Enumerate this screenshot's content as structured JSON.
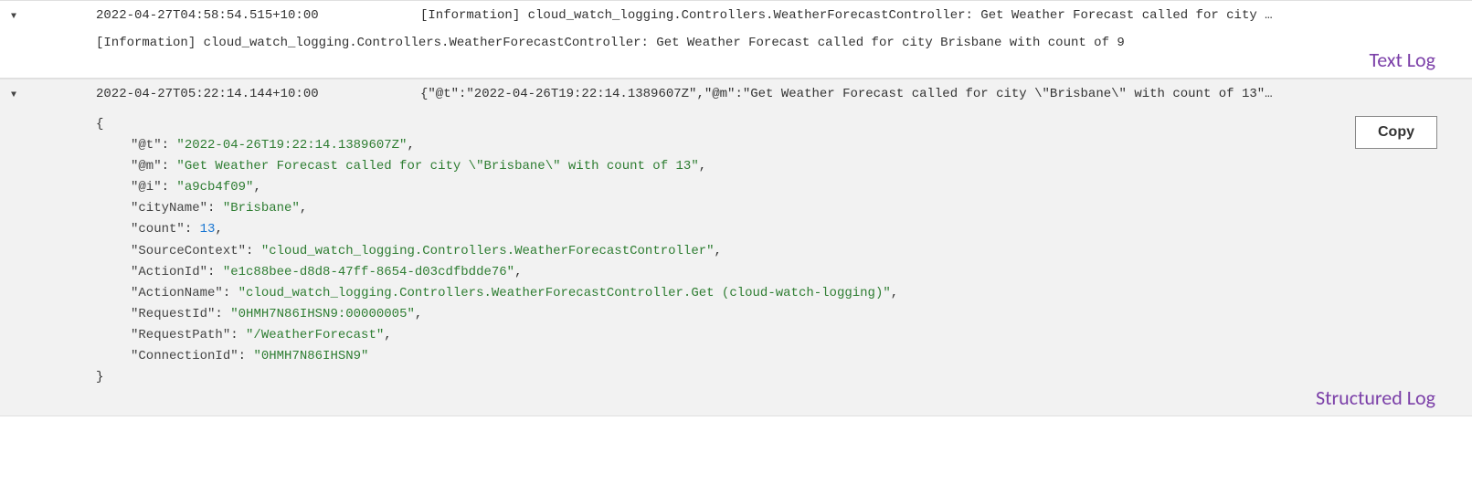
{
  "entries": [
    {
      "timestamp": "2022-04-27T04:58:54.515+10:00",
      "preview": "[Information] cloud_watch_logging.Controllers.WeatherForecastController: Get Weather Forecast called for city …",
      "expanded_text": "[Information] cloud_watch_logging.Controllers.WeatherForecastController: Get Weather Forecast called for city Brisbane with count of 9",
      "annotation": "Text Log"
    },
    {
      "timestamp": "2022-04-27T05:22:14.144+10:00",
      "preview": "{\"@t\":\"2022-04-26T19:22:14.1389607Z\",\"@m\":\"Get Weather Forecast called for city \\\"Brisbane\\\" with count of 13\"…",
      "json_fields": [
        {
          "key": "\"@t\"",
          "value": "\"2022-04-26T19:22:14.1389607Z\"",
          "type": "string"
        },
        {
          "key": "\"@m\"",
          "value": "\"Get Weather Forecast called for city \\\"Brisbane\\\" with count of 13\"",
          "type": "string"
        },
        {
          "key": "\"@i\"",
          "value": "\"a9cb4f09\"",
          "type": "string"
        },
        {
          "key": "\"cityName\"",
          "value": "\"Brisbane\"",
          "type": "string"
        },
        {
          "key": "\"count\"",
          "value": "13",
          "type": "number"
        },
        {
          "key": "\"SourceContext\"",
          "value": "\"cloud_watch_logging.Controllers.WeatherForecastController\"",
          "type": "string"
        },
        {
          "key": "\"ActionId\"",
          "value": "\"e1c88bee-d8d8-47ff-8654-d03cdfbdde76\"",
          "type": "string"
        },
        {
          "key": "\"ActionName\"",
          "value": "\"cloud_watch_logging.Controllers.WeatherForecastController.Get (cloud-watch-logging)\"",
          "type": "string"
        },
        {
          "key": "\"RequestId\"",
          "value": "\"0HMH7N86IHSN9:00000005\"",
          "type": "string"
        },
        {
          "key": "\"RequestPath\"",
          "value": "\"/WeatherForecast\"",
          "type": "string"
        },
        {
          "key": "\"ConnectionId\"",
          "value": "\"0HMH7N86IHSN9\"",
          "type": "string"
        }
      ],
      "copy_label": "Copy",
      "annotation": "Structured Log"
    }
  ]
}
